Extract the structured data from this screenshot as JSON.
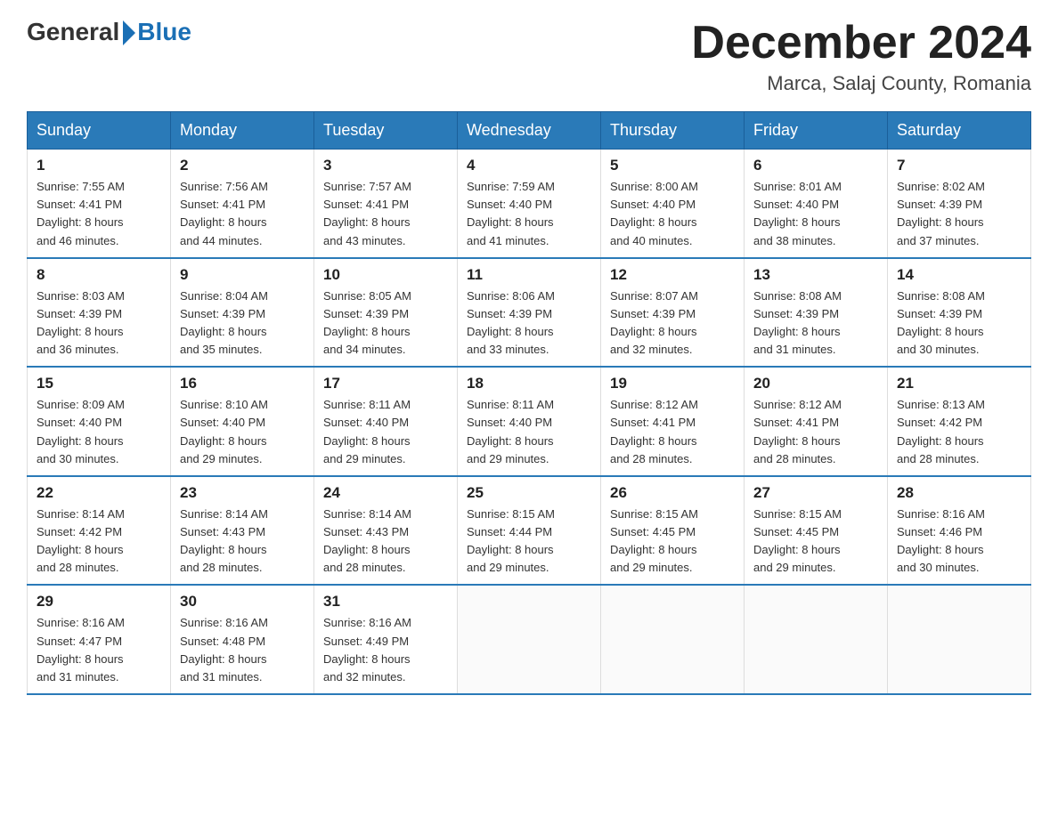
{
  "header": {
    "logo_general": "General",
    "logo_blue": "Blue",
    "month_year": "December 2024",
    "location": "Marca, Salaj County, Romania"
  },
  "days_of_week": [
    "Sunday",
    "Monday",
    "Tuesday",
    "Wednesday",
    "Thursday",
    "Friday",
    "Saturday"
  ],
  "weeks": [
    [
      {
        "day": "1",
        "sunrise": "7:55 AM",
        "sunset": "4:41 PM",
        "daylight": "8 hours and 46 minutes."
      },
      {
        "day": "2",
        "sunrise": "7:56 AM",
        "sunset": "4:41 PM",
        "daylight": "8 hours and 44 minutes."
      },
      {
        "day": "3",
        "sunrise": "7:57 AM",
        "sunset": "4:41 PM",
        "daylight": "8 hours and 43 minutes."
      },
      {
        "day": "4",
        "sunrise": "7:59 AM",
        "sunset": "4:40 PM",
        "daylight": "8 hours and 41 minutes."
      },
      {
        "day": "5",
        "sunrise": "8:00 AM",
        "sunset": "4:40 PM",
        "daylight": "8 hours and 40 minutes."
      },
      {
        "day": "6",
        "sunrise": "8:01 AM",
        "sunset": "4:40 PM",
        "daylight": "8 hours and 38 minutes."
      },
      {
        "day": "7",
        "sunrise": "8:02 AM",
        "sunset": "4:39 PM",
        "daylight": "8 hours and 37 minutes."
      }
    ],
    [
      {
        "day": "8",
        "sunrise": "8:03 AM",
        "sunset": "4:39 PM",
        "daylight": "8 hours and 36 minutes."
      },
      {
        "day": "9",
        "sunrise": "8:04 AM",
        "sunset": "4:39 PM",
        "daylight": "8 hours and 35 minutes."
      },
      {
        "day": "10",
        "sunrise": "8:05 AM",
        "sunset": "4:39 PM",
        "daylight": "8 hours and 34 minutes."
      },
      {
        "day": "11",
        "sunrise": "8:06 AM",
        "sunset": "4:39 PM",
        "daylight": "8 hours and 33 minutes."
      },
      {
        "day": "12",
        "sunrise": "8:07 AM",
        "sunset": "4:39 PM",
        "daylight": "8 hours and 32 minutes."
      },
      {
        "day": "13",
        "sunrise": "8:08 AM",
        "sunset": "4:39 PM",
        "daylight": "8 hours and 31 minutes."
      },
      {
        "day": "14",
        "sunrise": "8:08 AM",
        "sunset": "4:39 PM",
        "daylight": "8 hours and 30 minutes."
      }
    ],
    [
      {
        "day": "15",
        "sunrise": "8:09 AM",
        "sunset": "4:40 PM",
        "daylight": "8 hours and 30 minutes."
      },
      {
        "day": "16",
        "sunrise": "8:10 AM",
        "sunset": "4:40 PM",
        "daylight": "8 hours and 29 minutes."
      },
      {
        "day": "17",
        "sunrise": "8:11 AM",
        "sunset": "4:40 PM",
        "daylight": "8 hours and 29 minutes."
      },
      {
        "day": "18",
        "sunrise": "8:11 AM",
        "sunset": "4:40 PM",
        "daylight": "8 hours and 29 minutes."
      },
      {
        "day": "19",
        "sunrise": "8:12 AM",
        "sunset": "4:41 PM",
        "daylight": "8 hours and 28 minutes."
      },
      {
        "day": "20",
        "sunrise": "8:12 AM",
        "sunset": "4:41 PM",
        "daylight": "8 hours and 28 minutes."
      },
      {
        "day": "21",
        "sunrise": "8:13 AM",
        "sunset": "4:42 PM",
        "daylight": "8 hours and 28 minutes."
      }
    ],
    [
      {
        "day": "22",
        "sunrise": "8:14 AM",
        "sunset": "4:42 PM",
        "daylight": "8 hours and 28 minutes."
      },
      {
        "day": "23",
        "sunrise": "8:14 AM",
        "sunset": "4:43 PM",
        "daylight": "8 hours and 28 minutes."
      },
      {
        "day": "24",
        "sunrise": "8:14 AM",
        "sunset": "4:43 PM",
        "daylight": "8 hours and 28 minutes."
      },
      {
        "day": "25",
        "sunrise": "8:15 AM",
        "sunset": "4:44 PM",
        "daylight": "8 hours and 29 minutes."
      },
      {
        "day": "26",
        "sunrise": "8:15 AM",
        "sunset": "4:45 PM",
        "daylight": "8 hours and 29 minutes."
      },
      {
        "day": "27",
        "sunrise": "8:15 AM",
        "sunset": "4:45 PM",
        "daylight": "8 hours and 29 minutes."
      },
      {
        "day": "28",
        "sunrise": "8:16 AM",
        "sunset": "4:46 PM",
        "daylight": "8 hours and 30 minutes."
      }
    ],
    [
      {
        "day": "29",
        "sunrise": "8:16 AM",
        "sunset": "4:47 PM",
        "daylight": "8 hours and 31 minutes."
      },
      {
        "day": "30",
        "sunrise": "8:16 AM",
        "sunset": "4:48 PM",
        "daylight": "8 hours and 31 minutes."
      },
      {
        "day": "31",
        "sunrise": "8:16 AM",
        "sunset": "4:49 PM",
        "daylight": "8 hours and 32 minutes."
      },
      null,
      null,
      null,
      null
    ]
  ],
  "labels": {
    "sunrise": "Sunrise:",
    "sunset": "Sunset:",
    "daylight": "Daylight:"
  }
}
